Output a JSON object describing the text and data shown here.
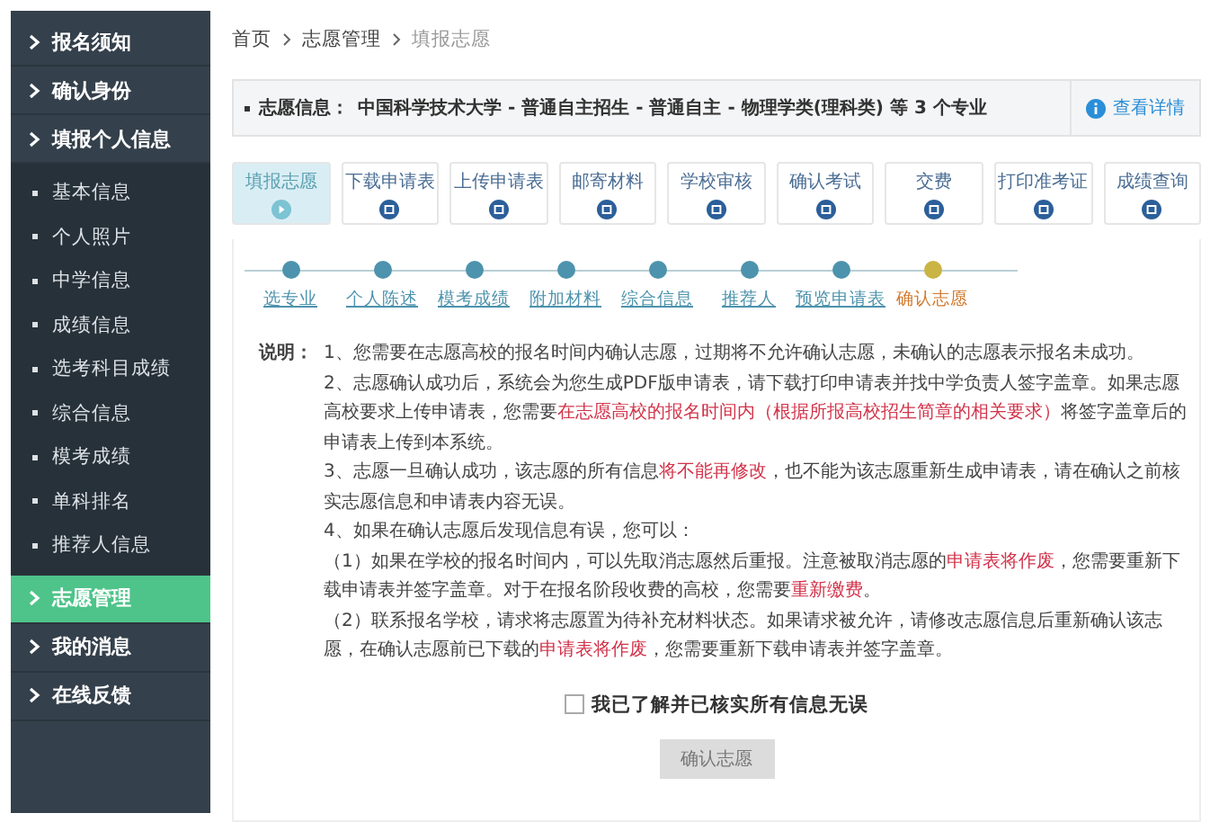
{
  "sidebar": {
    "items": [
      {
        "label": "报名须知",
        "selected": false
      },
      {
        "label": "确认身份",
        "selected": false
      },
      {
        "label": "填报个人信息",
        "selected": false,
        "expanded": true,
        "children": [
          {
            "label": "基本信息"
          },
          {
            "label": "个人照片"
          },
          {
            "label": "中学信息"
          },
          {
            "label": "成绩信息"
          },
          {
            "label": "选考科目成绩"
          },
          {
            "label": "综合信息"
          },
          {
            "label": "模考成绩"
          },
          {
            "label": "单科排名"
          },
          {
            "label": "推荐人信息"
          }
        ]
      },
      {
        "label": "志愿管理",
        "selected": true
      },
      {
        "label": "我的消息",
        "selected": false
      },
      {
        "label": "在线反馈",
        "selected": false
      }
    ]
  },
  "breadcrumb": [
    "首页",
    "志愿管理",
    "填报志愿"
  ],
  "info": {
    "label": "志愿信息：",
    "value": "中国科学技术大学 - 普通自主招生 - 普通自主 - 物理学类(理科类) 等 3 个专业",
    "link": "查看详情"
  },
  "tabs": [
    {
      "label": "填报志愿",
      "selected": true
    },
    {
      "label": "下载申请表",
      "selected": false
    },
    {
      "label": "上传申请表",
      "selected": false
    },
    {
      "label": "邮寄材料",
      "selected": false
    },
    {
      "label": "学校审核",
      "selected": false
    },
    {
      "label": "确认考试",
      "selected": false
    },
    {
      "label": "交费",
      "selected": false
    },
    {
      "label": "打印准考证",
      "selected": false
    },
    {
      "label": "成绩查询",
      "selected": false
    }
  ],
  "steps": [
    {
      "label": "选专业",
      "current": false
    },
    {
      "label": "个人陈述",
      "current": false
    },
    {
      "label": "模考成绩",
      "current": false
    },
    {
      "label": "附加材料",
      "current": false
    },
    {
      "label": "综合信息",
      "current": false
    },
    {
      "label": "推荐人",
      "current": false
    },
    {
      "label": "预览申请表",
      "current": false
    },
    {
      "label": "确认志愿",
      "current": true
    }
  ],
  "notes": {
    "label": "说明：",
    "paragraphs": [
      [
        {
          "text": "1、您需要在志愿高校的报名时间内确认志愿，过期将不允许确认志愿，未确认的志愿表示报名未成功。",
          "highlight": false
        }
      ],
      [
        {
          "text": "2、志愿确认成功后，系统会为您生成PDF版申请表，请下载打印申请表并找中学负责人签字盖章。如果志愿高校要求上传申请表，您需要",
          "highlight": false
        },
        {
          "text": "在志愿高校的报名时间内（根据所报高校招生简章的相关要求）",
          "highlight": true
        },
        {
          "text": "将签字盖章后的申请表上传到本系统。",
          "highlight": false
        }
      ],
      [
        {
          "text": "3、志愿一旦确认成功，该志愿的所有信息",
          "highlight": false
        },
        {
          "text": "将不能再修改",
          "highlight": true
        },
        {
          "text": "，也不能为该志愿重新生成申请表，请在确认之前核实志愿信息和申请表内容无误。",
          "highlight": false
        }
      ],
      [
        {
          "text": "4、如果在确认志愿后发现信息有误，您可以：",
          "highlight": false
        }
      ],
      [
        {
          "text": "（1）如果在学校的报名时间内，可以先取消志愿然后重报。注意被取消志愿的",
          "highlight": false
        },
        {
          "text": "申请表将作废",
          "highlight": true
        },
        {
          "text": "，您需要重新下载申请表并签字盖章。对于在报名阶段收费的高校，您需要",
          "highlight": false
        },
        {
          "text": "重新缴费",
          "highlight": true
        },
        {
          "text": "。",
          "highlight": false
        }
      ],
      [
        {
          "text": "（2）联系报名学校，请求将志愿置为待补充材料状态。如果请求被允许，请修改志愿信息后重新确认该志愿，在确认志愿前已下载的",
          "highlight": false
        },
        {
          "text": "申请表将作废",
          "highlight": true
        },
        {
          "text": "，您需要重新下载申请表并签字盖章。",
          "highlight": false
        }
      ]
    ]
  },
  "agreement": {
    "label": "我已了解并已核实所有信息无误",
    "checked": false
  },
  "confirm_button": {
    "label": "确认志愿",
    "disabled": true
  }
}
